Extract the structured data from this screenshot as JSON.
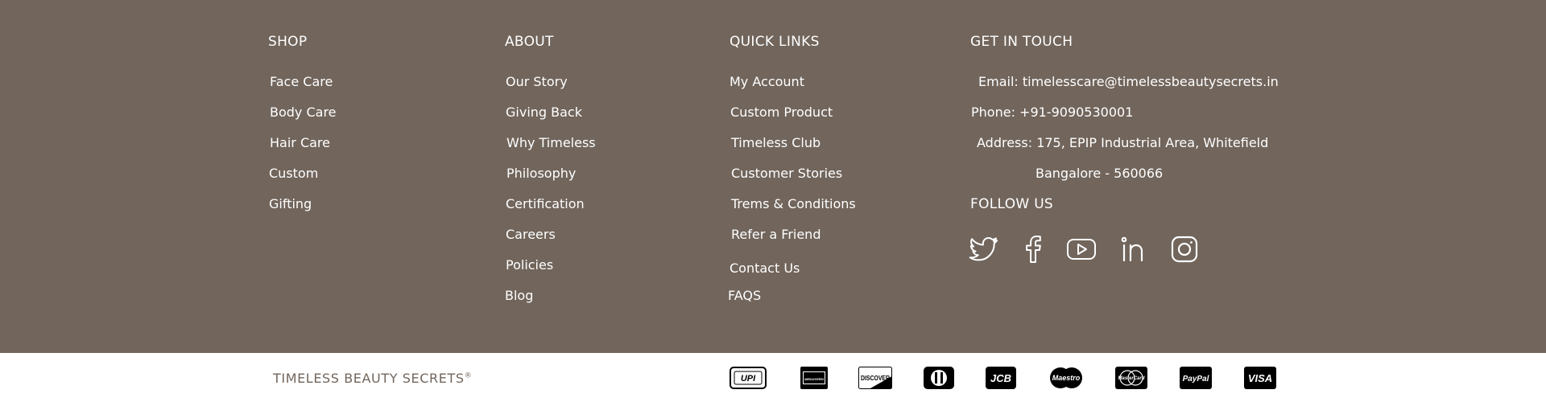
{
  "footer": {
    "shop": {
      "title": "SHOP",
      "items": [
        "Face Care",
        "Body Care",
        "Hair Care",
        "Custom",
        "Gifting"
      ]
    },
    "about": {
      "title": "ABOUT",
      "items": [
        "Our Story",
        "Giving Back",
        "Why Timeless",
        "Philosophy",
        "Certification",
        "Careers",
        "Policies",
        "Blog"
      ]
    },
    "quick_links": {
      "title": "QUICK LINKS",
      "items": [
        "My Account",
        "Custom Product",
        "Timeless Club",
        "Customer Stories",
        "Trems & Conditions",
        "Refer a Friend",
        "Contact Us",
        "FAQS"
      ]
    },
    "contact": {
      "title": "GET IN TOUCH",
      "email": "Email: timelesscare@timelessbeautysecrets.in",
      "phone": "Phone: +91-9090530001",
      "address_line1": "Address: 175, EPIP Industrial Area, Whitefield",
      "address_line2": "Bangalore - 560066",
      "follow_title": "FOLLOW US",
      "socials": [
        "twitter-icon",
        "facebook-icon",
        "youtube-icon",
        "linkedin-icon",
        "instagram-icon"
      ]
    }
  },
  "bottom": {
    "brand": "TIMELESS BEAUTY SECRETS",
    "brand_mark": "®",
    "payments": {
      "upi": "UPI",
      "amex": "AMERICAN EXPRESS",
      "discover": "DISCOVER",
      "diners": "",
      "jcb": "JCB",
      "maestro": "Maestro",
      "mastercard": "MasterCard",
      "paypal": "PayPal",
      "visa": "VISA"
    }
  },
  "colors": {
    "footer_bg": "#71655c",
    "text": "#ffffff",
    "brand": "#71655c",
    "badge": "#000000"
  }
}
